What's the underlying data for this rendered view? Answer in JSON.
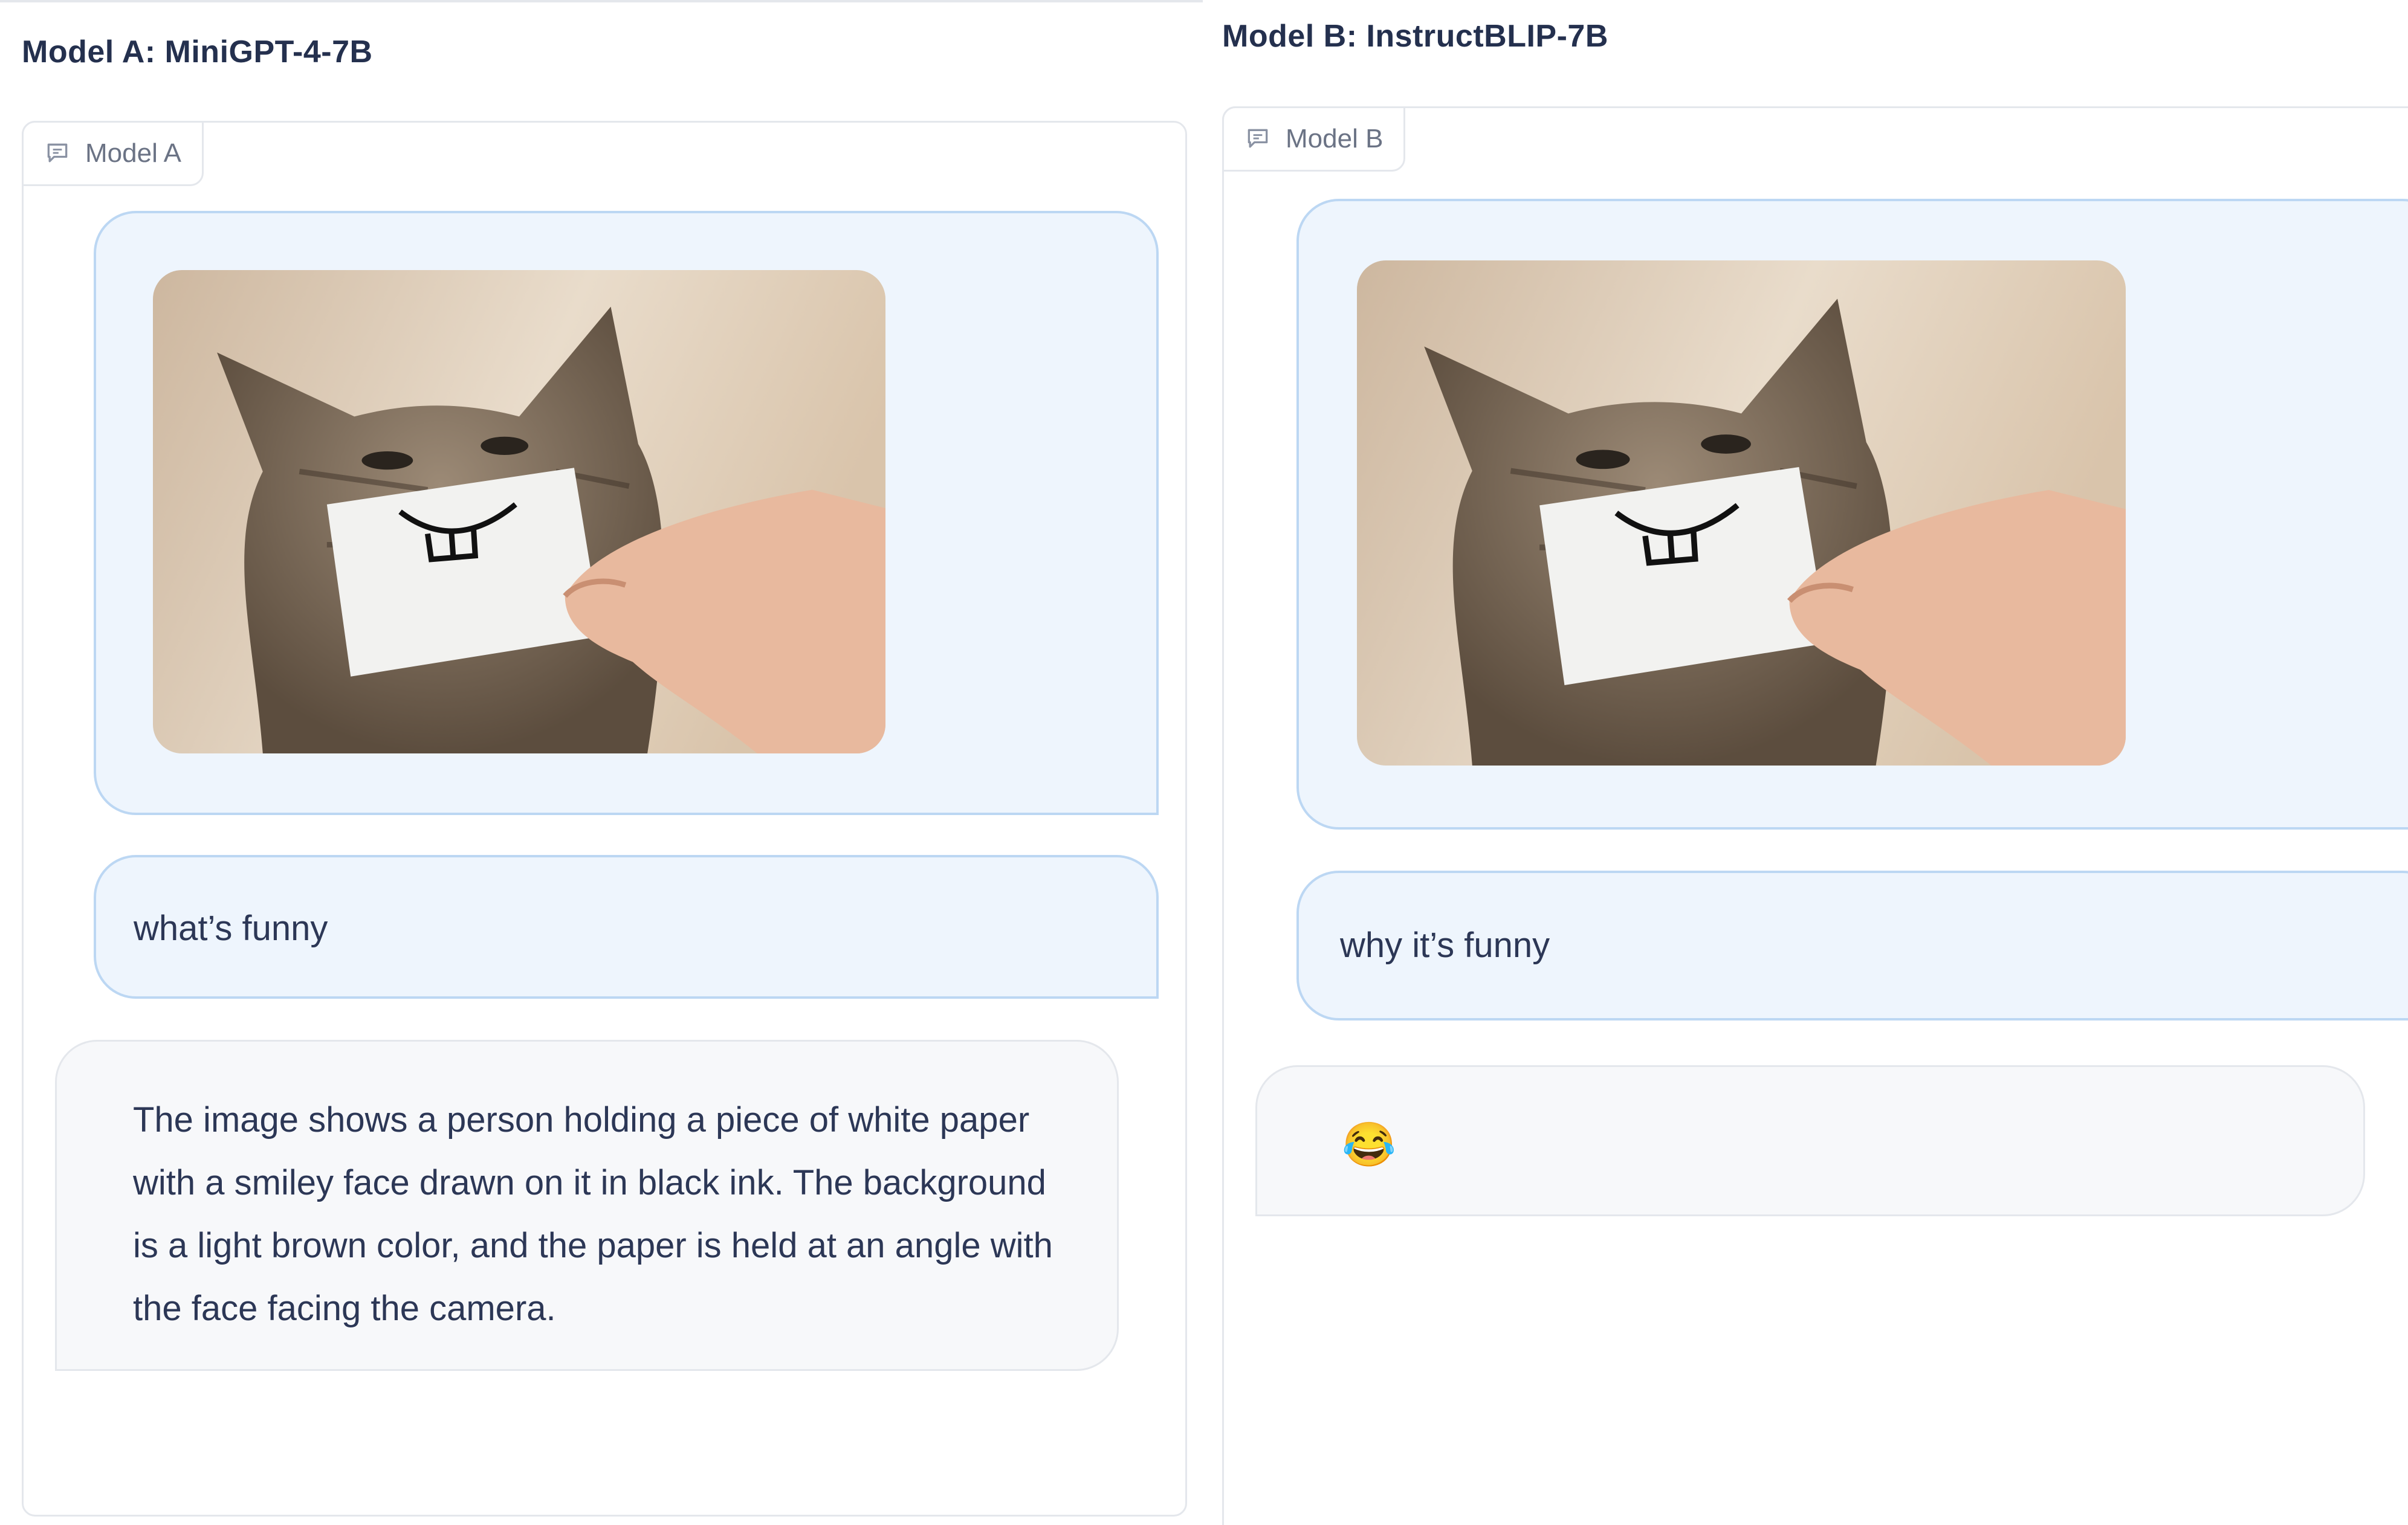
{
  "panels": [
    {
      "title": "Model A: MiniGPT-4-7B",
      "label": "Model A",
      "user_question": "what’s funny",
      "bot_response": "The image shows a person holding a piece of white paper with a smiley face drawn on it in black ink. The background is a light brown color, and the paper is held at an angle with the face facing the camera."
    },
    {
      "title": "Model B: InstructBLIP-7B",
      "label": "Model B",
      "user_question": "why it’s funny",
      "bot_response": "😂"
    }
  ],
  "colors": {
    "user_bubble_bg": "#eef5fd",
    "user_bubble_border": "#bcd7f3",
    "bot_bubble_bg": "#f7f8fa",
    "border": "#e4e7ec",
    "text": "#2c3756"
  },
  "icons": {
    "chip_icon": "chat-bubble-icon"
  }
}
